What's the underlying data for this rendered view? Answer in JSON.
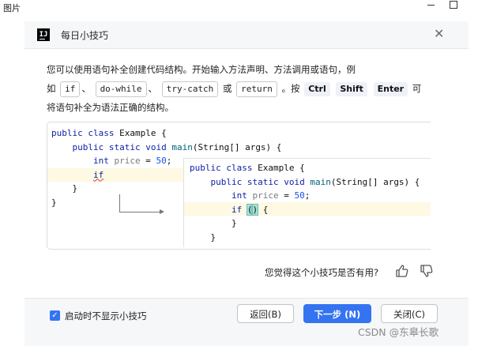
{
  "window": {
    "title": "图片"
  },
  "dialog": {
    "title": "每日小技巧"
  },
  "description": {
    "line1": "您可以使用语句补全创建代码结构。开始输入方法声明、方法调用或语句，例",
    "line2_prefix": "如",
    "kw_if": "if",
    "sep1": "、",
    "kw_do_while": "do-while",
    "sep2": "、",
    "kw_try_catch": "try-catch",
    "sep3": "或",
    "kw_return": "return",
    "sep4": "。按",
    "key_ctrl": "Ctrl",
    "key_shift": "Shift",
    "key_enter": "Enter",
    "line2_suffix": "可",
    "line3": "将语句补全为语法正确的结构。"
  },
  "code_before": {
    "l1_kw": "public class",
    "l1_rest": " Example {",
    "l2_kw": "public static void",
    "l2_fn": "main",
    "l2_rest": "(String[] args) {",
    "l3_kw": "int",
    "l3_var": "price",
    "l3_eq": " = ",
    "l3_num": "50",
    "l3_end": ";",
    "l4_kw": "if",
    "l5": "}",
    "l6": "}"
  },
  "code_after": {
    "l1_kw": "public class",
    "l1_rest": " Example {",
    "l2_kw": "public static void",
    "l2_fn": "main",
    "l2_rest": "(String[] args) {",
    "l3_kw": "int",
    "l3_var": "price",
    "l3_eq": " = ",
    "l3_num": "50",
    "l3_end": ";",
    "l4_kw": "if",
    "l4_paren_open": "(",
    "l4_paren_close": ")",
    "l4_brace": " {",
    "l5": "}",
    "l6": "}"
  },
  "feedback": {
    "question": "您觉得这个小技巧是否有用?",
    "thumbs_up_icon": "thumbs-up-icon",
    "thumbs_down_icon": "thumbs-down-icon"
  },
  "footer": {
    "checkbox_checked": true,
    "checkbox_label": "启动时不显示小技巧",
    "back_label": "返回(B)",
    "next_label": "下一步 (N)",
    "close_label": "关闭(C)"
  },
  "watermark": "CSDN @东皋长歌",
  "colors": {
    "accent": "#3574f0",
    "keyword": "#0b1fa6",
    "function": "#00627a",
    "number": "#1750eb",
    "highlight": "#fdf9e3"
  }
}
